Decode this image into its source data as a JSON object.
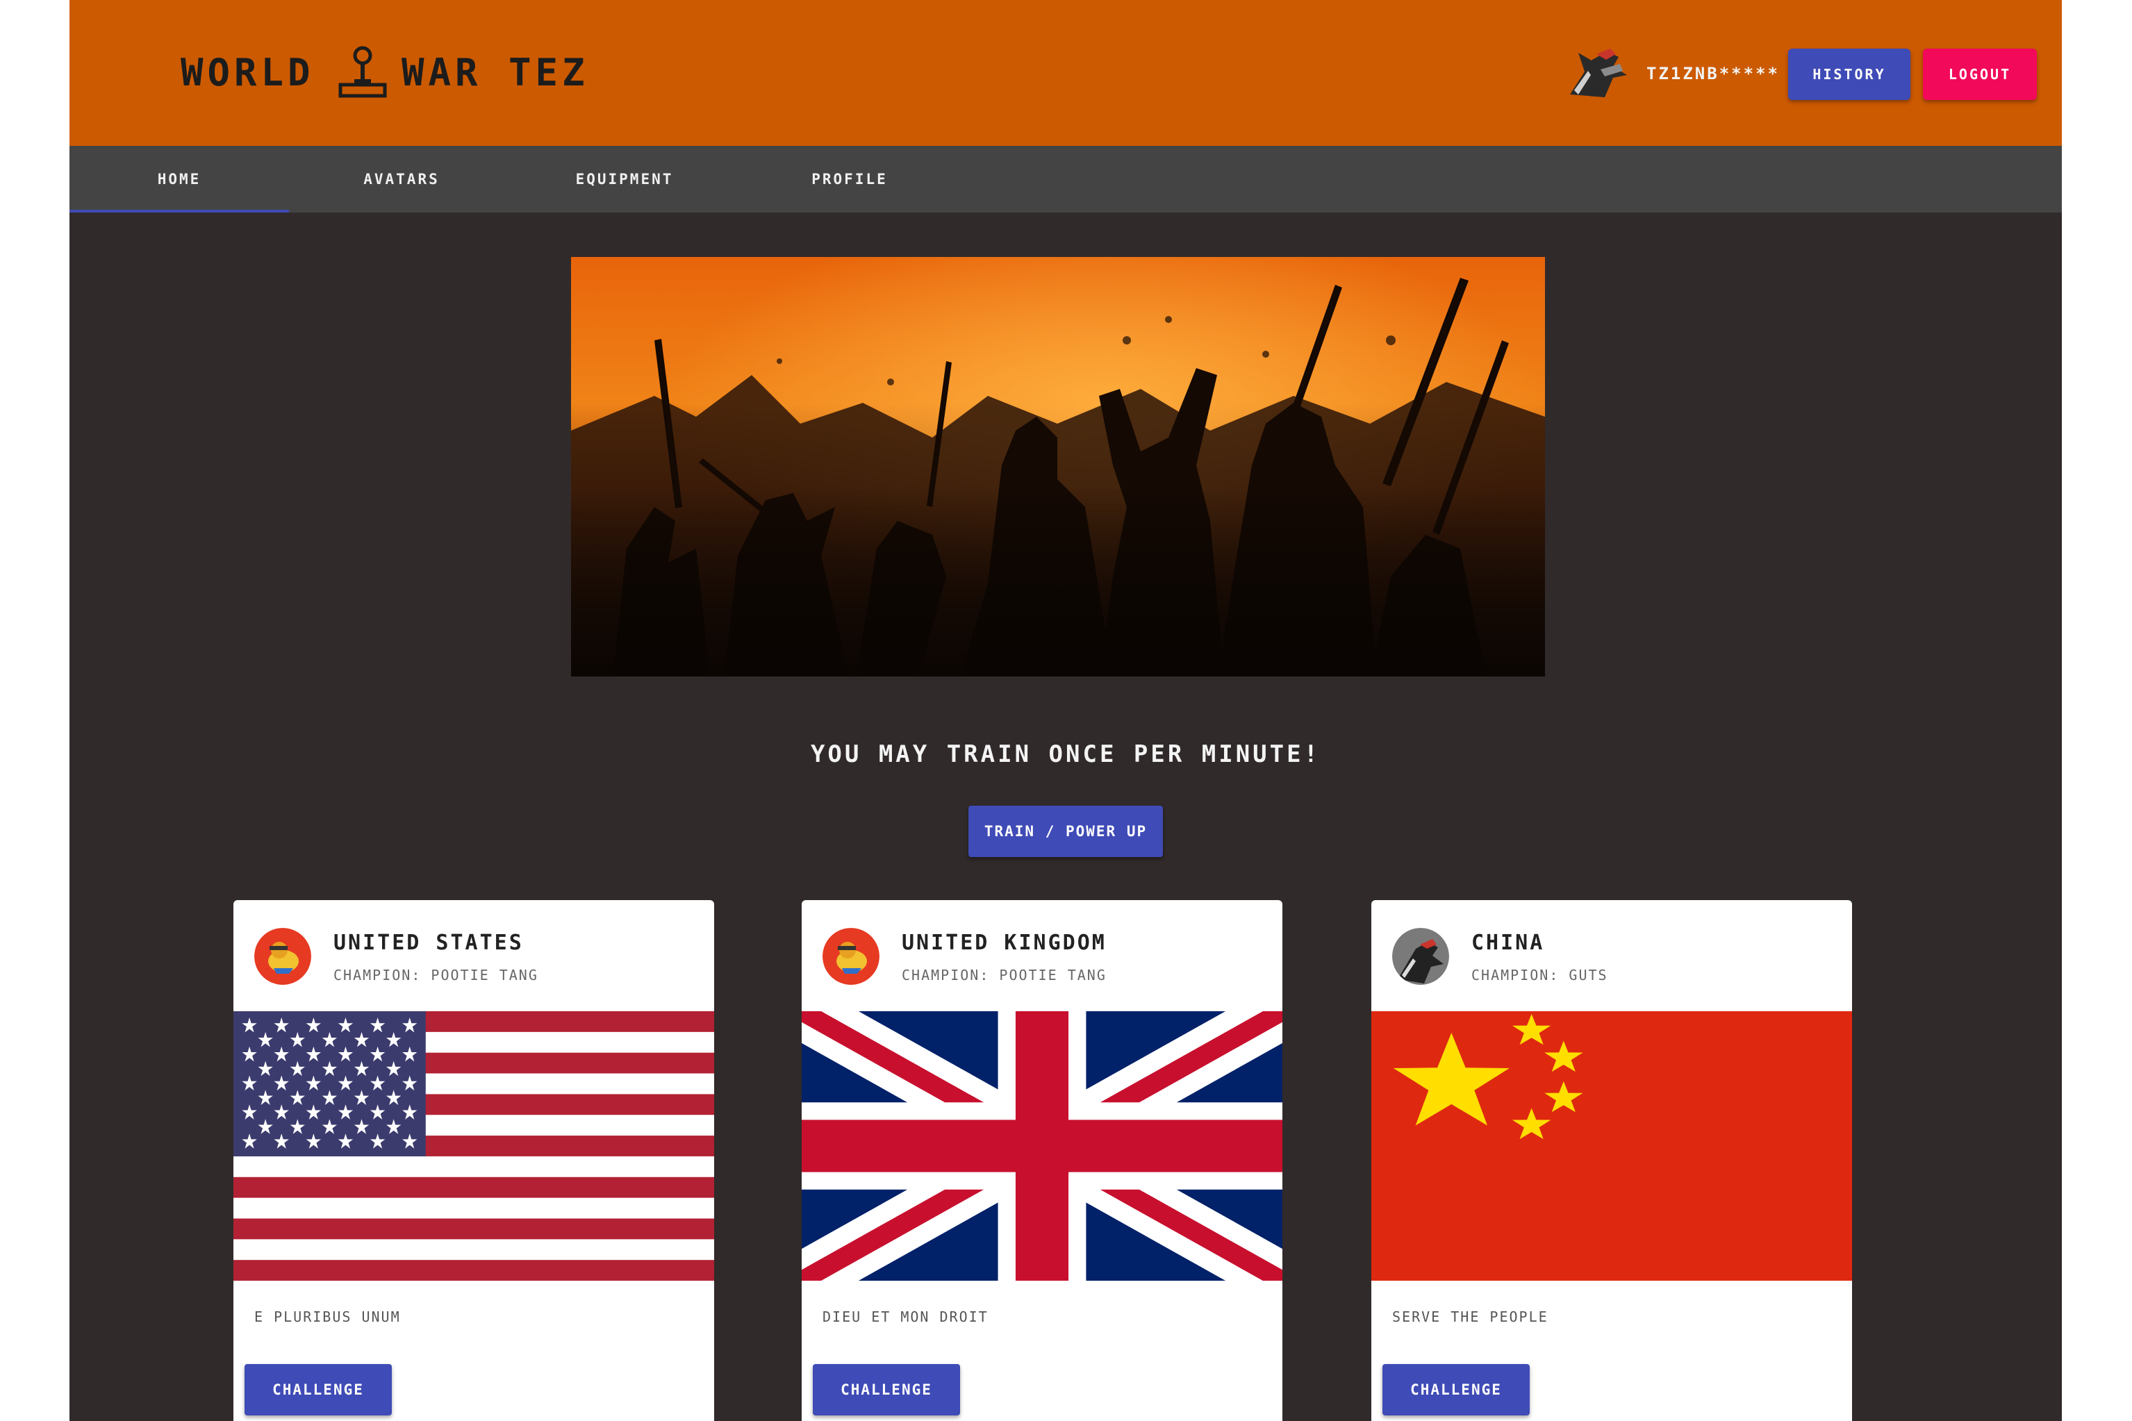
{
  "header": {
    "logo_word1": "WORLD",
    "logo_word2": "WAR TEZ",
    "logo_icon": "joystick-icon",
    "username": "TZ1ZNB*****",
    "history_label": "HISTORY",
    "logout_label": "LOGOUT",
    "colors": {
      "bar": "#cc5a00",
      "history": "#3f4bb6",
      "logout": "#f2095a"
    }
  },
  "nav": {
    "tabs": [
      {
        "label": "HOME",
        "active": true
      },
      {
        "label": "AVATARS",
        "active": false
      },
      {
        "label": "EQUIPMENT",
        "active": false
      },
      {
        "label": "PROFILE",
        "active": false
      }
    ]
  },
  "main": {
    "train_message": "YOU MAY TRAIN ONCE PER MINUTE!",
    "train_button": "TRAIN / POWER UP"
  },
  "cards": [
    {
      "country": "UNITED STATES",
      "champion": "CHAMPION: POOTIE TANG",
      "motto": "E PLURIBUS UNUM",
      "button": "CHALLENGE",
      "flag": "us-flag",
      "avatar": "pootie-tang-avatar"
    },
    {
      "country": "UNITED KINGDOM",
      "champion": "CHAMPION: POOTIE TANG",
      "motto": "DIEU ET MON DROIT",
      "button": "CHALLENGE",
      "flag": "uk-flag",
      "avatar": "pootie-tang-avatar"
    },
    {
      "country": "CHINA",
      "champion": "CHAMPION: GUTS",
      "motto": "SERVE THE PEOPLE",
      "button": "CHALLENGE",
      "flag": "china-flag",
      "avatar": "guts-avatar"
    }
  ],
  "theme": {
    "background": "#312a2a",
    "nav": "#444444",
    "accent": "#3f4bb6"
  }
}
